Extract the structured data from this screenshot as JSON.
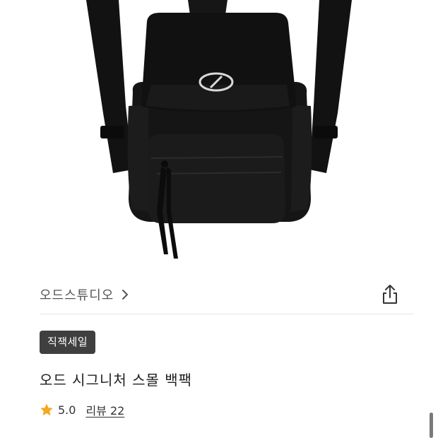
{
  "product": {
    "image_alt": "black mini backpack",
    "brand": "오드스튜디오",
    "badge": "직잭세일",
    "title": "오드 시그니처 스몰 백팩",
    "rating": "5.0",
    "review_label": "리뷰 22"
  },
  "icons": {
    "brand_chevron": "chevron-right-icon",
    "share": "share-icon",
    "star": "star-icon"
  },
  "colors": {
    "badge_bg": "#3f3f3f",
    "star": "#f5a623",
    "backpack": "#141414"
  }
}
